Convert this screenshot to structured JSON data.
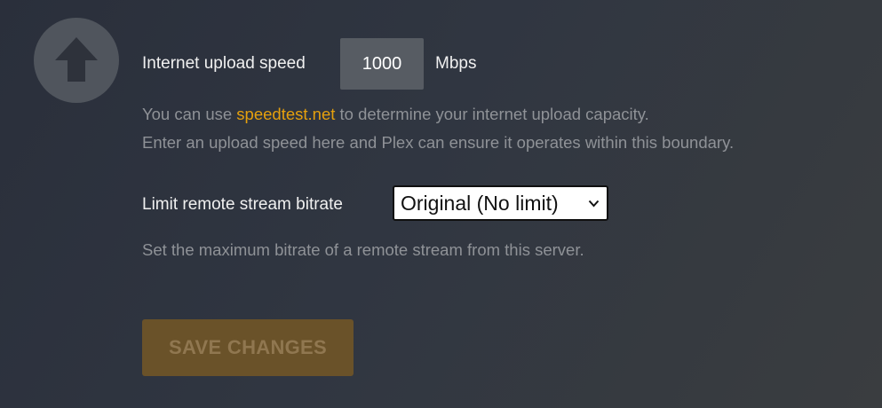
{
  "upload_speed": {
    "label": "Internet upload speed",
    "value": "1000",
    "unit": "Mbps",
    "icon": "upload-arrow-icon"
  },
  "hints": {
    "speedtest_prefix": "You can use ",
    "speedtest_link": "speedtest.net",
    "speedtest_suffix": " to determine your internet upload capacity.",
    "boundary_text": "Enter an upload speed here and Plex can ensure it operates within this boundary."
  },
  "bitrate": {
    "label": "Limit remote stream bitrate",
    "selected": "Original (No limit)",
    "hint": "Set the maximum bitrate of a remote stream from this server."
  },
  "actions": {
    "save_label": "SAVE CHANGES"
  },
  "colors": {
    "accent": "#e5a00d",
    "hint_text": "#8f9297",
    "button_bg": "#6a5229"
  }
}
